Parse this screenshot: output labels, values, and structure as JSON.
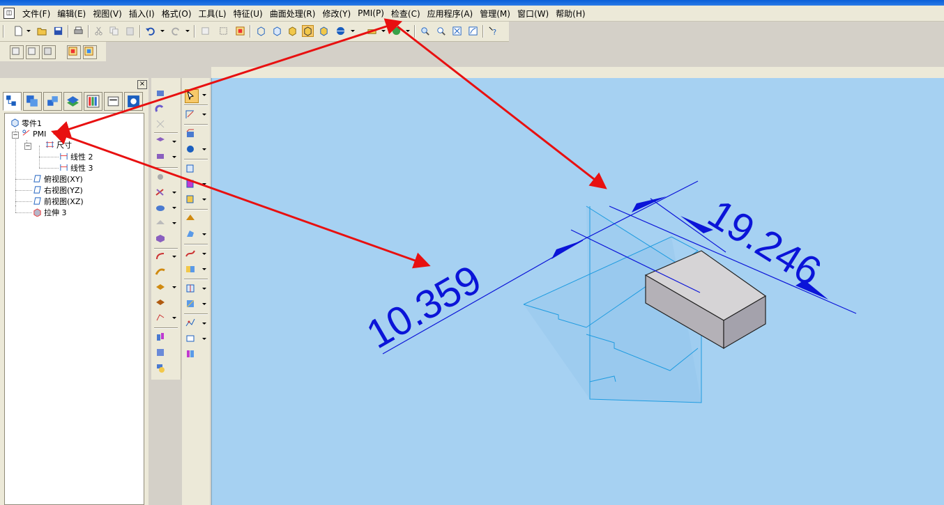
{
  "menu": {
    "items": [
      {
        "label": "文件(F)"
      },
      {
        "label": "编辑(E)"
      },
      {
        "label": "视图(V)"
      },
      {
        "label": "插入(I)"
      },
      {
        "label": "格式(O)"
      },
      {
        "label": "工具(L)"
      },
      {
        "label": "特征(U)"
      },
      {
        "label": "曲面处理(R)"
      },
      {
        "label": "修改(Y)"
      },
      {
        "label": "PMI(P)"
      },
      {
        "label": "检查(C)"
      },
      {
        "label": "应用程序(A)"
      },
      {
        "label": "管理(M)"
      },
      {
        "label": "窗口(W)"
      },
      {
        "label": "帮助(H)"
      }
    ]
  },
  "panel": {
    "close_glyph": "×",
    "tabs": [
      {
        "icon": "feature-pathfinder-icon"
      },
      {
        "icon": "layers-icon"
      },
      {
        "icon": "assembly-icon"
      },
      {
        "icon": "sketch-layers-icon"
      },
      {
        "icon": "family-icon"
      },
      {
        "icon": "library-icon"
      },
      {
        "icon": "settings-icon"
      }
    ]
  },
  "tree": {
    "part": "零件1",
    "pmi": "PMI",
    "dimensions": "尺寸",
    "linear2": "线性 2",
    "linear3": "线性 3",
    "plane_top": "俯视图(XY)",
    "plane_right": "右视图(YZ)",
    "plane_front": "前视图(XZ)",
    "extrude": "拉伸 3",
    "collapse_glyph": "−"
  },
  "viewport": {
    "dim_left": "10.359",
    "dim_right": "19.246",
    "colors": {
      "background": "#a6d1f2",
      "dimension": "#0b14d8",
      "planes": "#1e9be0",
      "arrow": "#e81010",
      "box_top": "#d6d4d6",
      "box_front": "#b4b1b7"
    }
  }
}
